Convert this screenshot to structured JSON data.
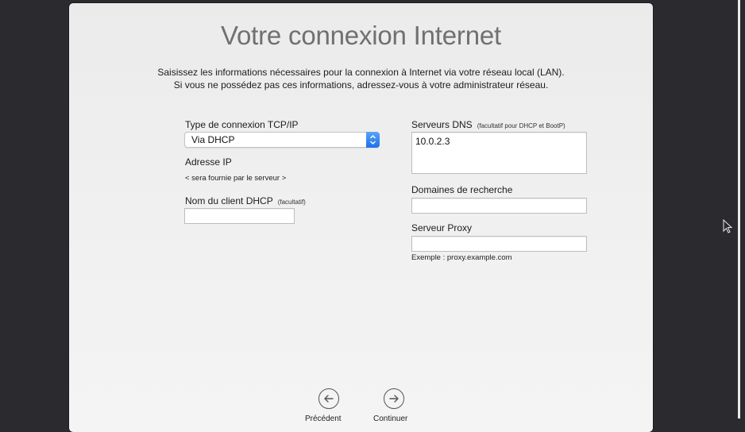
{
  "title": "Votre connexion Internet",
  "intro": {
    "line1": "Saisissez les informations nécessaires pour la connexion à Internet via votre réseau local (LAN).",
    "line2": "Si vous ne possédez pas ces informations, adressez-vous à votre administrateur réseau."
  },
  "tcpip": {
    "label": "Type de connexion TCP/IP",
    "value": "Via DHCP"
  },
  "ip": {
    "label": "Adresse IP",
    "note": "< sera fournie par le serveur >"
  },
  "dhcp_client": {
    "label": "Nom du client DHCP",
    "hint": "(facultatif)",
    "value": ""
  },
  "dns": {
    "label": "Serveurs DNS",
    "hint": "(facultatif pour DHCP et BootP)",
    "value": "10.0.2.3"
  },
  "search_domains": {
    "label": "Domaines de recherche",
    "value": ""
  },
  "proxy": {
    "label": "Serveur Proxy",
    "value": "",
    "example": "Exemple : proxy.example.com"
  },
  "nav": {
    "back_label": "Précédent",
    "next_label": "Continuer"
  }
}
